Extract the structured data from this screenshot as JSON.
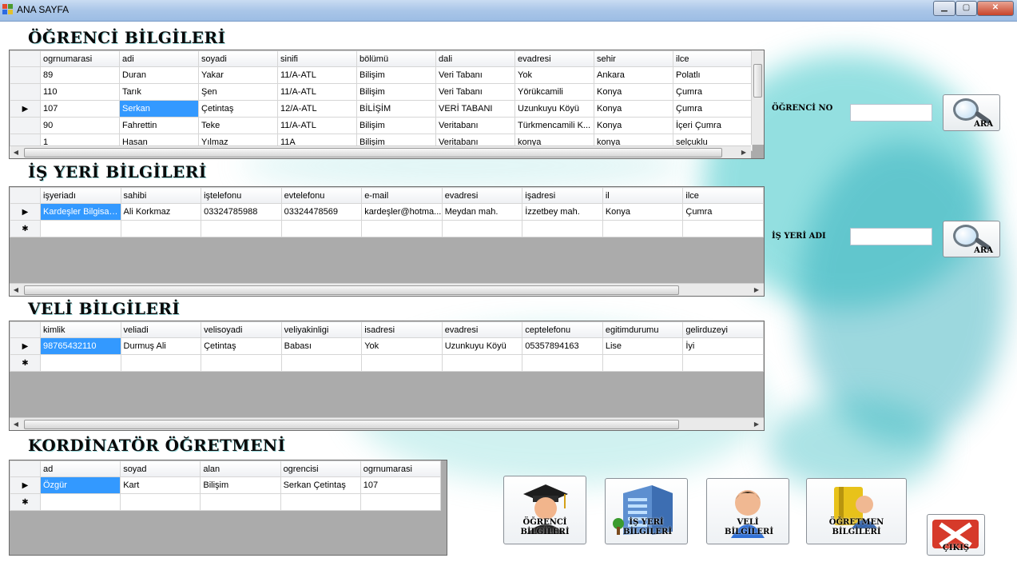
{
  "window": {
    "title": "ANA SAYFA",
    "minimize_glyph": "▁",
    "maximize_glyph": "▢",
    "close_glyph": "✕"
  },
  "student_section": {
    "title": "ÖĞRENCİ BİLGİLERİ",
    "columns": [
      "ogrnumarasi",
      "adi",
      "soyadi",
      "sinifi",
      "bölümü",
      "dali",
      "evadresi",
      "sehir",
      "ilce"
    ],
    "rows": [
      [
        "89",
        "Duran",
        "Yakar",
        "11/A-ATL",
        "Bilişim",
        "Veri Tabanı",
        "Yok",
        "Ankara",
        "Polatlı"
      ],
      [
        "110",
        "Tarık",
        "Şen",
        "11/A-ATL",
        "Bilişim",
        "Veri Tabanı",
        "Yörükcamili",
        "Konya",
        "Çumra"
      ],
      [
        "107",
        "Serkan",
        "Çetintaş",
        "12/A-ATL",
        "BİLİŞİM",
        "VERİ TABANI",
        "Uzunkuyu Köyü",
        "Konya",
        "Çumra"
      ],
      [
        "90",
        "Fahrettin",
        "Teke",
        "11/A-ATL",
        "Bilişim",
        "Veritabanı",
        "Türkmencamili K...",
        "Konya",
        "İçeri Çumra"
      ],
      [
        "1",
        "Hasan",
        "Yılmaz",
        "11A",
        "Bilişim",
        "Veritabanı",
        "konya",
        "konya",
        "selçuklu"
      ]
    ],
    "current_row_marker": "▶"
  },
  "workplace_section": {
    "title": "İŞ YERİ BİLGİLERİ",
    "columns": [
      "işyeriadı",
      "sahibi",
      "iştelefonu",
      "evtelefonu",
      "e-mail",
      "evadresi",
      "işadresi",
      "il",
      "ilce"
    ],
    "rows": [
      [
        "Kardeşler Bilgisayar",
        "Ali Korkmaz",
        "03324785988",
        "03324478569",
        "kardeşler@hotma...",
        "Meydan mah.",
        "İzzetbey mah.",
        "Konya",
        "Çumra"
      ]
    ],
    "current_row_marker": "▶",
    "new_row_marker": "✱"
  },
  "parent_section": {
    "title": "VELİ BİLGİLERİ",
    "columns": [
      "kimlik",
      "veliadi",
      "velisoyadi",
      "veliyakinligi",
      "isadresi",
      "evadresi",
      "ceptelefonu",
      "egitimdurumu",
      "gelirduzeyi"
    ],
    "rows": [
      [
        "98765432110",
        "Durmuş Ali",
        "Çetintaş",
        "Babası",
        "Yok",
        "Uzunkuyu Köyü",
        "05357894163",
        "Lise",
        "İyi"
      ]
    ],
    "current_row_marker": "▶",
    "new_row_marker": "✱"
  },
  "coordinator_section": {
    "title": "KORDİNATÖR ÖĞRETMENİ",
    "columns": [
      "ad",
      "soyad",
      "alan",
      "ogrencisi",
      "ogrnumarasi"
    ],
    "rows": [
      [
        "Özgür",
        "Kart",
        "Bilişim",
        "Serkan Çetintaş",
        "107"
      ]
    ],
    "current_row_marker": "▶",
    "new_row_marker": "✱"
  },
  "search": {
    "student_no_label": "ÖĞRENCİ NO",
    "student_no_value": "",
    "workplace_name_label": "İŞ YERİ ADI",
    "workplace_name_value": "",
    "button_label": "ARA"
  },
  "nav_buttons": {
    "student": "ÖĞRENCİ BİLGİLERİ",
    "workplace": "İŞ YERİ BİLGİLERİ",
    "parent": "VELİ BİLGİLERİ",
    "teacher": "ÖĞRETMEN BİLGİLERİ",
    "exit": "ÇIKIŞ"
  },
  "colors": {
    "selection": "#3399ff",
    "splash": "#3cc6c8"
  }
}
